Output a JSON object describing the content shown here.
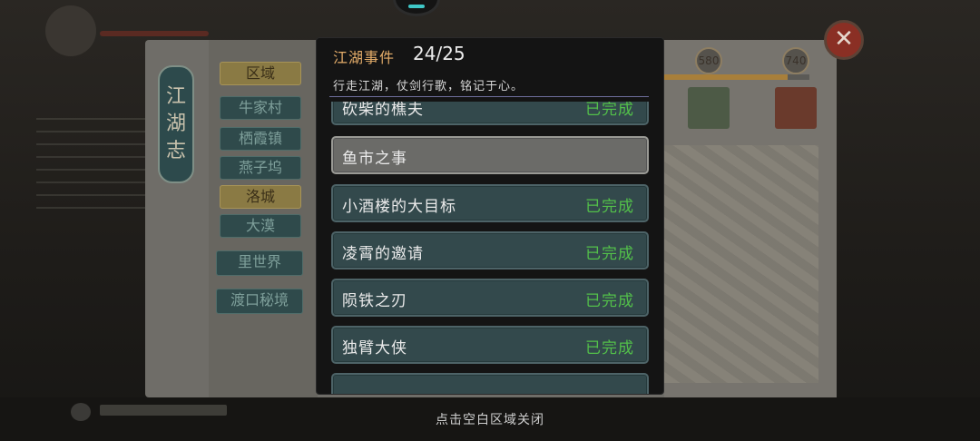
{
  "background": {
    "journal_title": "江湖志",
    "side_menu": [
      {
        "label": "区域",
        "style": "gold"
      },
      {
        "label": "牛家村",
        "style": "teal"
      },
      {
        "label": "栖霞镇",
        "style": "teal"
      },
      {
        "label": "燕子坞",
        "style": "teal"
      },
      {
        "label": "洛城",
        "style": "gold"
      },
      {
        "label": "大漠",
        "style": "teal"
      }
    ],
    "extra_menu": [
      {
        "label": "里世界"
      },
      {
        "label": "渡口秘境"
      }
    ],
    "reward_points": [
      "580",
      "740"
    ],
    "close_label": "✕"
  },
  "modal": {
    "title": "江湖事件",
    "count": "24/25",
    "subtitle": "行走江湖，仗剑行歌，铭记于心。",
    "items": [
      {
        "name": "砍柴的樵夫",
        "status": "已完成",
        "state": "done"
      },
      {
        "name": "鱼市之事",
        "status": "",
        "state": "locked"
      },
      {
        "name": "小酒楼的大目标",
        "status": "已完成",
        "state": "done"
      },
      {
        "name": "凌霄的邀请",
        "status": "已完成",
        "state": "done"
      },
      {
        "name": "陨铁之刃",
        "status": "已完成",
        "state": "done"
      },
      {
        "name": "独臂大侠",
        "status": "已完成",
        "state": "done"
      },
      {
        "name": "",
        "status": "",
        "state": "done"
      }
    ]
  },
  "hint": "点击空白区域关闭"
}
